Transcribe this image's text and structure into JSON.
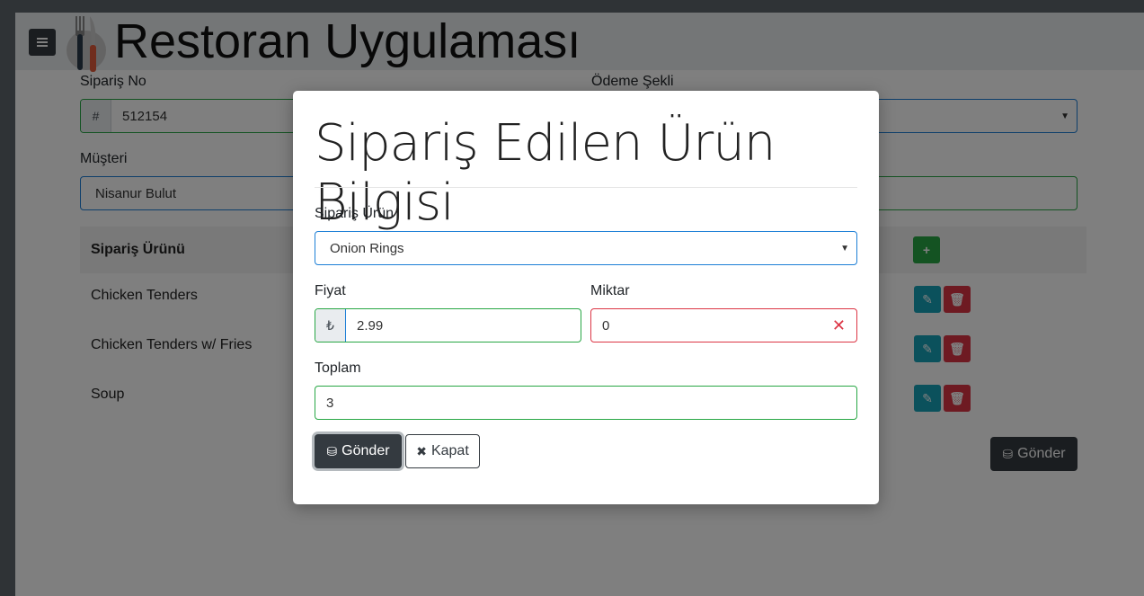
{
  "header": {
    "title": "Restoran Uygulaması",
    "menu_icon": "hamburger-icon",
    "logo_icon": "fork-knife-icon"
  },
  "form": {
    "siparis_no_label": "Sipariş No",
    "siparis_no_prefix": "#",
    "siparis_no_value": "512154",
    "odeme_label": "Ödeme Şekli",
    "musteri_label": "Müşteri",
    "musteri_value": "Nisanur Bulut"
  },
  "table": {
    "header": "Sipariş Ürünü",
    "rows": [
      {
        "name": "Chicken Tenders"
      },
      {
        "name": "Chicken Tenders w/ Fries"
      },
      {
        "name": "Soup"
      }
    ],
    "submit_label": "Gönder"
  },
  "modal": {
    "title": "Sipariş Edilen Ürün Bilgisi",
    "product_label": "Sipariş Ürün",
    "product_value": "Onion Rings",
    "price_label": "Fiyat",
    "price_prefix": "₺",
    "price_value": "2.99",
    "qty_label": "Miktar",
    "qty_value": "0",
    "total_label": "Toplam",
    "total_value": "3",
    "submit_label": "Gönder",
    "close_label": "Kapat"
  },
  "colors": {
    "valid": "#28a745",
    "invalid": "#dc3545",
    "focus": "#1d7fd6",
    "dark": "#343a40",
    "info": "#17a2b8"
  }
}
